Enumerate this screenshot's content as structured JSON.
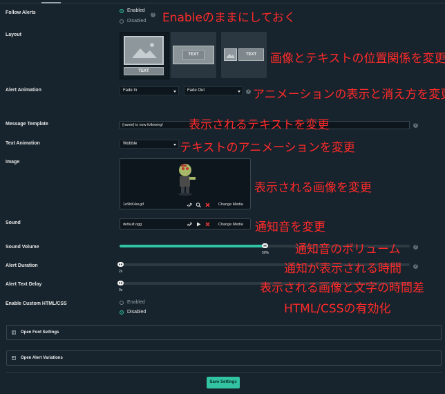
{
  "follow_alerts": {
    "label": "Follow Alerts",
    "options": [
      "Enabled",
      "Disabled"
    ],
    "selected": "Enabled",
    "annotation": "Enableのままにしておく"
  },
  "layout": {
    "label": "Layout",
    "card_text": "TEXT",
    "annotation": "画像とテキストの位置関係を変更"
  },
  "alert_animation": {
    "label": "Alert Animation",
    "in_value": "Fade In",
    "out_value": "Fade Out",
    "annotation": "アニメーションの表示と消え方を変更"
  },
  "message_template": {
    "label": "Message Template",
    "value": "{name} is now following!",
    "annotation": "表示されるテキストを変更"
  },
  "text_animation": {
    "label": "Text Animation",
    "value": "Wobble",
    "annotation": "テキストのアニメーションを変更"
  },
  "image": {
    "label": "Image",
    "filename": "1e9bK4w.gif",
    "change_media": "Change Media",
    "annotation": "表示される画像を変更"
  },
  "sound": {
    "label": "Sound",
    "filename": "default.ogg",
    "change_media": "Change Media",
    "annotation": "通知音を変更"
  },
  "sound_volume": {
    "label": "Sound Volume",
    "value_text": "50%",
    "fraction": 0.5,
    "annotation": "通知音のボリューム"
  },
  "alert_duration": {
    "label": "Alert Duration",
    "value_text": "2s",
    "annotation": "通知が表示される時間"
  },
  "alert_text_delay": {
    "label": "Alert Text Delay",
    "value_text": "0s",
    "annotation": "表示される画像と文字の時間差"
  },
  "custom_html": {
    "label": "Enable Custom HTML/CSS",
    "options": [
      "Enabled",
      "Disabled"
    ],
    "selected": "Disabled",
    "annotation": "HTML/CSSの有効化"
  },
  "sections": {
    "font_settings": "Open Font Settings",
    "alert_variations": "Open Alert Variations"
  },
  "save_label": "Save Settings",
  "colors": {
    "background": "#17242d",
    "accent": "#31c3a2",
    "annotation": "#ff2a2a"
  },
  "icons": {
    "help": "question-circle-icon",
    "link": "link-icon",
    "zoom": "zoom-icon",
    "remove": "remove-x-icon",
    "play": "play-icon"
  }
}
